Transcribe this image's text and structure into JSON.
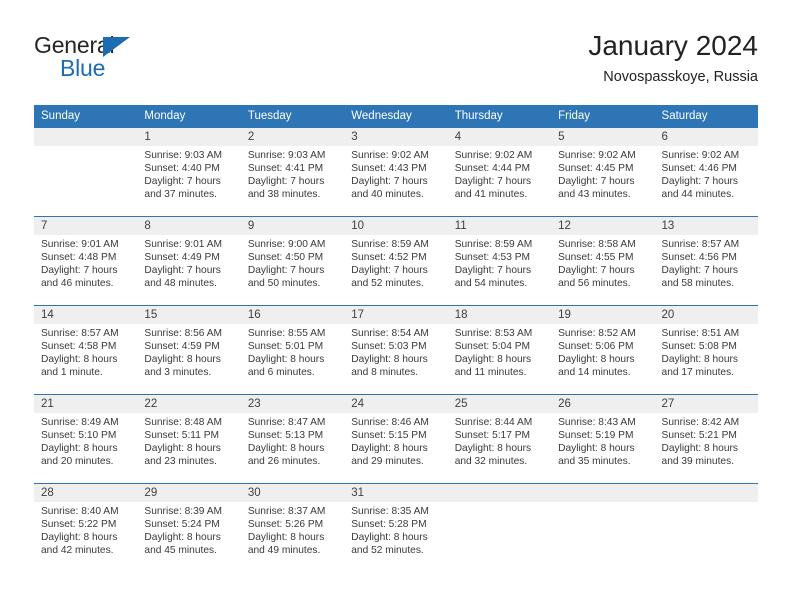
{
  "brand": {
    "name_part1": "General",
    "name_part2": "Blue",
    "triangle_color": "#1b6cb0"
  },
  "header": {
    "title": "January 2024",
    "subtitle": "Novospasskoye, Russia"
  },
  "theme": {
    "header_bg": "#2e75b6",
    "daynum_bg": "#efefef",
    "row_divider": "#2e75b6",
    "text": "#3a3a3a"
  },
  "calendar": {
    "weekday_headers": [
      "Sunday",
      "Monday",
      "Tuesday",
      "Wednesday",
      "Thursday",
      "Friday",
      "Saturday"
    ],
    "weeks": [
      [
        {
          "day": "",
          "sunrise": "",
          "sunset": "",
          "daylight": ""
        },
        {
          "day": "1",
          "sunrise": "Sunrise: 9:03 AM",
          "sunset": "Sunset: 4:40 PM",
          "daylight": "Daylight: 7 hours and 37 minutes."
        },
        {
          "day": "2",
          "sunrise": "Sunrise: 9:03 AM",
          "sunset": "Sunset: 4:41 PM",
          "daylight": "Daylight: 7 hours and 38 minutes."
        },
        {
          "day": "3",
          "sunrise": "Sunrise: 9:02 AM",
          "sunset": "Sunset: 4:43 PM",
          "daylight": "Daylight: 7 hours and 40 minutes."
        },
        {
          "day": "4",
          "sunrise": "Sunrise: 9:02 AM",
          "sunset": "Sunset: 4:44 PM",
          "daylight": "Daylight: 7 hours and 41 minutes."
        },
        {
          "day": "5",
          "sunrise": "Sunrise: 9:02 AM",
          "sunset": "Sunset: 4:45 PM",
          "daylight": "Daylight: 7 hours and 43 minutes."
        },
        {
          "day": "6",
          "sunrise": "Sunrise: 9:02 AM",
          "sunset": "Sunset: 4:46 PM",
          "daylight": "Daylight: 7 hours and 44 minutes."
        }
      ],
      [
        {
          "day": "7",
          "sunrise": "Sunrise: 9:01 AM",
          "sunset": "Sunset: 4:48 PM",
          "daylight": "Daylight: 7 hours and 46 minutes."
        },
        {
          "day": "8",
          "sunrise": "Sunrise: 9:01 AM",
          "sunset": "Sunset: 4:49 PM",
          "daylight": "Daylight: 7 hours and 48 minutes."
        },
        {
          "day": "9",
          "sunrise": "Sunrise: 9:00 AM",
          "sunset": "Sunset: 4:50 PM",
          "daylight": "Daylight: 7 hours and 50 minutes."
        },
        {
          "day": "10",
          "sunrise": "Sunrise: 8:59 AM",
          "sunset": "Sunset: 4:52 PM",
          "daylight": "Daylight: 7 hours and 52 minutes."
        },
        {
          "day": "11",
          "sunrise": "Sunrise: 8:59 AM",
          "sunset": "Sunset: 4:53 PM",
          "daylight": "Daylight: 7 hours and 54 minutes."
        },
        {
          "day": "12",
          "sunrise": "Sunrise: 8:58 AM",
          "sunset": "Sunset: 4:55 PM",
          "daylight": "Daylight: 7 hours and 56 minutes."
        },
        {
          "day": "13",
          "sunrise": "Sunrise: 8:57 AM",
          "sunset": "Sunset: 4:56 PM",
          "daylight": "Daylight: 7 hours and 58 minutes."
        }
      ],
      [
        {
          "day": "14",
          "sunrise": "Sunrise: 8:57 AM",
          "sunset": "Sunset: 4:58 PM",
          "daylight": "Daylight: 8 hours and 1 minute."
        },
        {
          "day": "15",
          "sunrise": "Sunrise: 8:56 AM",
          "sunset": "Sunset: 4:59 PM",
          "daylight": "Daylight: 8 hours and 3 minutes."
        },
        {
          "day": "16",
          "sunrise": "Sunrise: 8:55 AM",
          "sunset": "Sunset: 5:01 PM",
          "daylight": "Daylight: 8 hours and 6 minutes."
        },
        {
          "day": "17",
          "sunrise": "Sunrise: 8:54 AM",
          "sunset": "Sunset: 5:03 PM",
          "daylight": "Daylight: 8 hours and 8 minutes."
        },
        {
          "day": "18",
          "sunrise": "Sunrise: 8:53 AM",
          "sunset": "Sunset: 5:04 PM",
          "daylight": "Daylight: 8 hours and 11 minutes."
        },
        {
          "day": "19",
          "sunrise": "Sunrise: 8:52 AM",
          "sunset": "Sunset: 5:06 PM",
          "daylight": "Daylight: 8 hours and 14 minutes."
        },
        {
          "day": "20",
          "sunrise": "Sunrise: 8:51 AM",
          "sunset": "Sunset: 5:08 PM",
          "daylight": "Daylight: 8 hours and 17 minutes."
        }
      ],
      [
        {
          "day": "21",
          "sunrise": "Sunrise: 8:49 AM",
          "sunset": "Sunset: 5:10 PM",
          "daylight": "Daylight: 8 hours and 20 minutes."
        },
        {
          "day": "22",
          "sunrise": "Sunrise: 8:48 AM",
          "sunset": "Sunset: 5:11 PM",
          "daylight": "Daylight: 8 hours and 23 minutes."
        },
        {
          "day": "23",
          "sunrise": "Sunrise: 8:47 AM",
          "sunset": "Sunset: 5:13 PM",
          "daylight": "Daylight: 8 hours and 26 minutes."
        },
        {
          "day": "24",
          "sunrise": "Sunrise: 8:46 AM",
          "sunset": "Sunset: 5:15 PM",
          "daylight": "Daylight: 8 hours and 29 minutes."
        },
        {
          "day": "25",
          "sunrise": "Sunrise: 8:44 AM",
          "sunset": "Sunset: 5:17 PM",
          "daylight": "Daylight: 8 hours and 32 minutes."
        },
        {
          "day": "26",
          "sunrise": "Sunrise: 8:43 AM",
          "sunset": "Sunset: 5:19 PM",
          "daylight": "Daylight: 8 hours and 35 minutes."
        },
        {
          "day": "27",
          "sunrise": "Sunrise: 8:42 AM",
          "sunset": "Sunset: 5:21 PM",
          "daylight": "Daylight: 8 hours and 39 minutes."
        }
      ],
      [
        {
          "day": "28",
          "sunrise": "Sunrise: 8:40 AM",
          "sunset": "Sunset: 5:22 PM",
          "daylight": "Daylight: 8 hours and 42 minutes."
        },
        {
          "day": "29",
          "sunrise": "Sunrise: 8:39 AM",
          "sunset": "Sunset: 5:24 PM",
          "daylight": "Daylight: 8 hours and 45 minutes."
        },
        {
          "day": "30",
          "sunrise": "Sunrise: 8:37 AM",
          "sunset": "Sunset: 5:26 PM",
          "daylight": "Daylight: 8 hours and 49 minutes."
        },
        {
          "day": "31",
          "sunrise": "Sunrise: 8:35 AM",
          "sunset": "Sunset: 5:28 PM",
          "daylight": "Daylight: 8 hours and 52 minutes."
        },
        {
          "day": "",
          "sunrise": "",
          "sunset": "",
          "daylight": ""
        },
        {
          "day": "",
          "sunrise": "",
          "sunset": "",
          "daylight": ""
        },
        {
          "day": "",
          "sunrise": "",
          "sunset": "",
          "daylight": ""
        }
      ]
    ]
  }
}
